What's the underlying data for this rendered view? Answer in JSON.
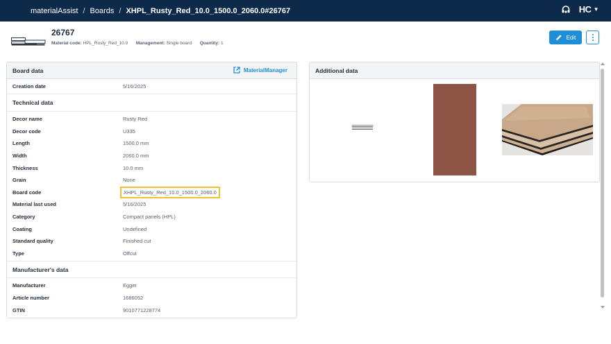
{
  "nav": {
    "app": "materialAssist",
    "sep": "/",
    "boards": "Boards",
    "current": "XHPL_Rusty_Red_10.0_1500.0_2060.0#26767",
    "brand": "HC",
    "support_icon": "headset-icon"
  },
  "header": {
    "board_id": "26767",
    "material_code_label": "Material code:",
    "material_code": "HPL_Rusty_Red_10.0",
    "management_label": "Management:",
    "management": "Single board",
    "quantity_label": "Quantity:",
    "quantity": "1",
    "edit_label": "Edit"
  },
  "board_data": {
    "title": "Board data",
    "material_manager": "MaterialManager",
    "creation_date_label": "Creation date",
    "creation_date": "5/16/2025"
  },
  "technical": {
    "title": "Technical data",
    "rows": [
      {
        "k": "Decor name",
        "v": "Rusty Red"
      },
      {
        "k": "Decor code",
        "v": "U335"
      },
      {
        "k": "Length",
        "v": "1500.0 mm"
      },
      {
        "k": "Width",
        "v": "2060.0 mm"
      },
      {
        "k": "Thickness",
        "v": "10.0 mm"
      },
      {
        "k": "Grain",
        "v": "None"
      },
      {
        "k": "Board code",
        "v": "XHPL_Rusty_Red_10.0_1500.0_2060.0"
      },
      {
        "k": "Material last used",
        "v": "5/16/2025"
      },
      {
        "k": "Category",
        "v": "Compact panels (HPL)"
      },
      {
        "k": "Coating",
        "v": "Undefined"
      },
      {
        "k": "Standard quality",
        "v": "Finished cut"
      },
      {
        "k": "Type",
        "v": "Offcut"
      }
    ]
  },
  "manufacturer": {
    "title": "Manufacturer's data",
    "rows": [
      {
        "k": "Manufacturer",
        "v": "Egger"
      },
      {
        "k": "Article number",
        "v": "1686052"
      },
      {
        "k": "GTIN",
        "v": "9010771228774"
      }
    ]
  },
  "additional": {
    "title": "Additional data",
    "swatch_color": "#8e5446"
  },
  "colors": {
    "topbar": "#0e2a4a",
    "accent": "#1e8fd6",
    "highlight": "#f2c12e"
  }
}
